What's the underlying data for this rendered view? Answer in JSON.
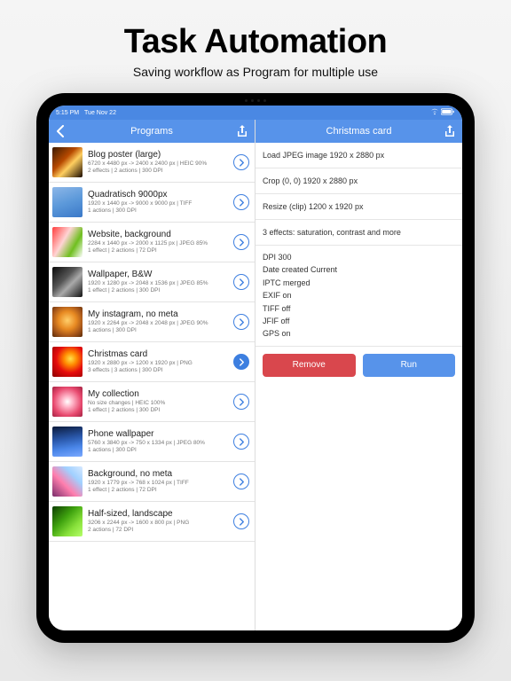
{
  "hero": {
    "title": "Task Automation",
    "subtitle": "Saving workflow as Program for multiple use"
  },
  "status": {
    "time": "5:15 PM",
    "date": "Tue Nov 22"
  },
  "left": {
    "back": "<",
    "title": "Programs",
    "items": [
      {
        "title": "Blog poster (large)",
        "line1": "6720 x 4480 px -> 2400 x 2400 px | HEIC 90%",
        "line2": "2 effects | 2 actions | 300 DPI",
        "thumb": "linear-gradient(135deg,#3a1a00 0%,#b84a00 40%,#ffcf60 60%,#1a0a00 100%)",
        "selected": false
      },
      {
        "title": "Quadratisch 9000px",
        "line1": "1920 x 1440 px -> 9000 x 9000 px | TIFF",
        "line2": "1 actions | 300 DPI",
        "thumb": "linear-gradient(160deg,#8db7e8 0%, #5c99da 50%, #3a78c8 100%)",
        "selected": false
      },
      {
        "title": "Website, background",
        "line1": "2284 x 1440 px -> 2000 x 1125 px | JPEG 85%",
        "line2": "1 effect | 2 actions | 72 DPI",
        "thumb": "linear-gradient(120deg,#ff3d3d 0%, #ffd4d4 40%, #6fbf1f 70%, #ffffff 100%)",
        "selected": false
      },
      {
        "title": "Wallpaper, B&W",
        "line1": "1920 x 1280 px -> 2048 x 1536 px | JPEG 85%",
        "line2": "1 effect | 2 actions | 300 DPI",
        "thumb": "linear-gradient(135deg,#0a0a0a 0%, #555 40%, #aaa 60%, #111 100%)",
        "selected": false
      },
      {
        "title": "My instagram, no meta",
        "line1": "1920 x 2264 px -> 2048 x 2048 px | JPEG 90%",
        "line2": "1 actions | 300 DPI",
        "thumb": "radial-gradient(circle at 50% 45%, #ffcf6b 0%, #e88a22 40%, #a5551a 70%, #5a2a08 100%)",
        "selected": false
      },
      {
        "title": "Christmas card",
        "line1": "1920 x 2880 px -> 1200 x 1920 px | PNG",
        "line2": "3 effects | 3 actions | 300 DPI",
        "thumb": "radial-gradient(circle at 60% 40%, #ffe14a 0%, #ff8a00 25%, #e60c0c 55%, #8a0000 100%)",
        "selected": true
      },
      {
        "title": "My collection",
        "line1": "No size changes | HEIC 100%",
        "line2": "1 effect | 2 actions | 300 DPI",
        "thumb": "radial-gradient(circle at 50% 50%, #fff 0%, #ffb6c9 25%, #e84a6f 65%, #a52243 100%)",
        "selected": false
      },
      {
        "title": "Phone wallpaper",
        "line1": "5760 x 3840 px -> 750 x 1334 px | JPEG 80%",
        "line2": "1 actions | 300 DPI",
        "thumb": "linear-gradient(170deg,#0b1a3a 0%, #2956a8 40%, #4a86e8 70%, #7aa9ff 100%)",
        "selected": false
      },
      {
        "title": "Background, no meta",
        "line1": "1920 x 1779 px -> 768 x 1024 px | TIFF",
        "line2": "1 effect | 2 actions | 72 DPI",
        "thumb": "linear-gradient(45deg,#7a2d6b 0%, #ff7fae 40%, #a0d0ff 70%, #d7e9ff 100%)",
        "selected": false
      },
      {
        "title": "Half-sized, landscape",
        "line1": "3206 x 2244 px -> 1600 x 800 px | PNG",
        "line2": "2 actions | 72 DPI",
        "thumb": "linear-gradient(135deg,#0d3d00 0%, #3fa20f 40%, #87e03a 70%, #b6ff6a 100%)",
        "selected": false
      }
    ]
  },
  "right": {
    "title": "Christmas card",
    "steps": [
      "Load JPEG image 1920 x 2880 px",
      "Crop (0, 0) 1920 x 2880 px",
      "Resize (clip) 1200 x 1920 px",
      "3 effects: saturation, contrast and more"
    ],
    "meta": [
      "DPI 300",
      "Date created Current",
      "IPTC merged",
      "EXIF on",
      "TIFF off",
      "JFIF off",
      "GPS on"
    ],
    "remove": "Remove",
    "run": "Run"
  }
}
